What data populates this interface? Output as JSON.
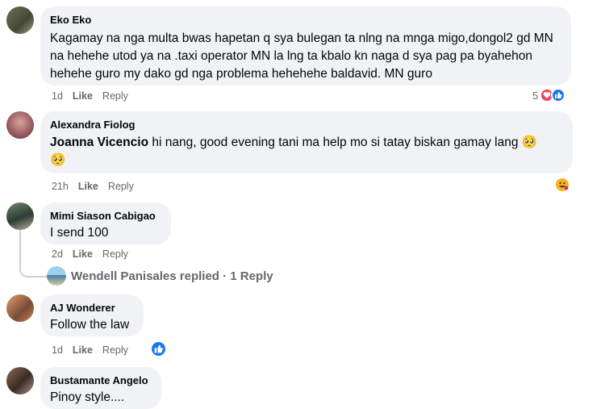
{
  "comments": [
    {
      "author": "Eko Eko",
      "text": "Kagamay na nga multa bwas hapetan q sya bulegan ta nlng na mnga migo,dongol2 gd MN na hehehe utod ya na .taxi operator MN la lng ta kbalo kn naga d sya pag pa byahehon hehehe guro my dako gd nga problema hehehehe baldavid. MN guro",
      "time": "1d",
      "like": "Like",
      "reply": "Reply",
      "reaction_count": "5"
    },
    {
      "author": "Alexandra Fiolog",
      "mention": "Joanna Vicencio",
      "text": " hi nang, good evening tani ma help mo si tatay biskan gamay lang 🥺 🥺",
      "time": "21h",
      "like": "Like",
      "reply": "Reply"
    },
    {
      "author": "Mimi Siason Cabigao",
      "text": "I send 100",
      "time": "2d",
      "like": "Like",
      "reply": "Reply",
      "replies_text": "Wendell Panisales replied · 1 Reply"
    },
    {
      "author": "AJ Wonderer",
      "text": "Follow the law",
      "time": "1d",
      "like": "Like",
      "reply": "Reply"
    },
    {
      "author": "Bustamante Angelo",
      "text": "Pinoy style...."
    }
  ],
  "colors": {
    "like_blue": "#1877f2",
    "love_red": "#f33e58",
    "haha_yellow": "#f7b125",
    "meta_gray": "#65676b",
    "bubble_bg": "#f0f2f5"
  },
  "icons": [
    "heart-reaction-icon",
    "like-reaction-icon",
    "haha-reaction-icon"
  ]
}
